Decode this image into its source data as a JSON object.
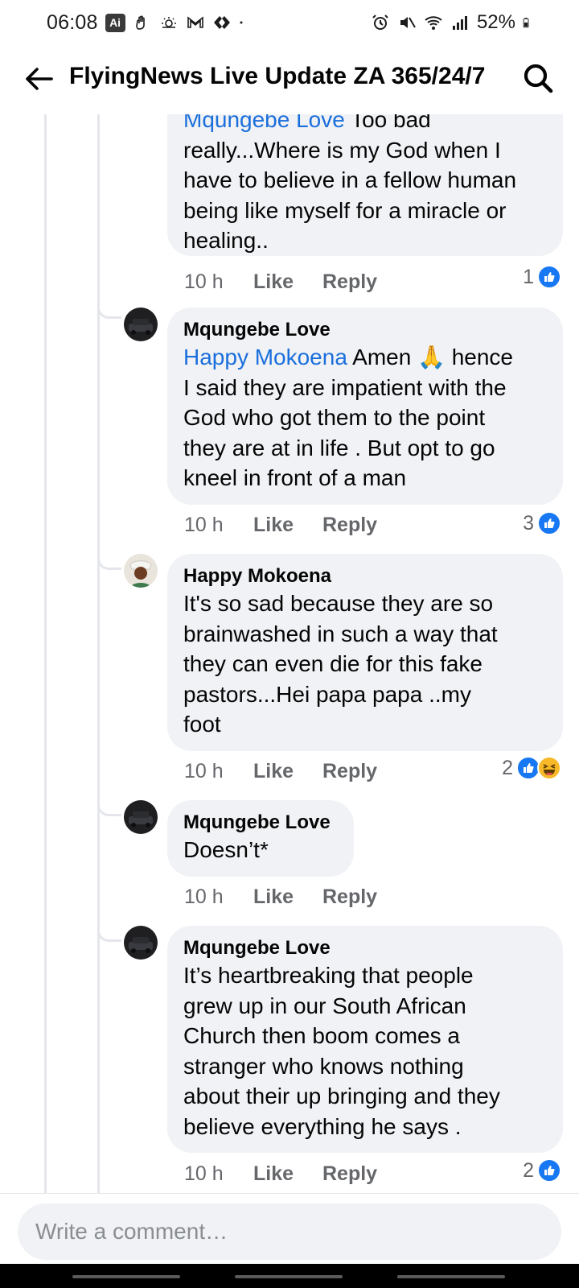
{
  "status_bar": {
    "time": "06:08",
    "ai_badge": "Ai",
    "battery": "52%"
  },
  "header": {
    "title": "FlyingNews Live Update ZA 365/24/7",
    "back_icon": "arrow-left-icon",
    "search_icon": "search-icon"
  },
  "comments": [
    {
      "author": "Mqungebe Love",
      "mention": "",
      "partial_first_line": "Mqungebe Love Too bad",
      "lines": [
        "really...Where is my God when I",
        "have to believe in a fellow human",
        "being like myself for a miracle or",
        "healing.."
      ],
      "time": "10 h",
      "like": "Like",
      "reply": "Reply",
      "reaction_count": "1",
      "reactions": [
        "like"
      ]
    },
    {
      "author": "Mqungebe Love",
      "mention": "Happy Mokoena",
      "first_line_rest": " Amen 🙏 hence",
      "lines": [
        "I said they are impatient with the",
        "God who got them to the point",
        "they are at in life . But opt to go",
        "kneel in front of a man"
      ],
      "time": "10 h",
      "like": "Like",
      "reply": "Reply",
      "reaction_count": "3",
      "reactions": [
        "like"
      ]
    },
    {
      "author": "Happy Mokoena",
      "lines": [
        "It's so sad because they are so",
        "brainwashed in such a way that",
        "they can even die for this fake",
        "pastors...Hei papa papa ..my",
        "foot"
      ],
      "time": "10 h",
      "like": "Like",
      "reply": "Reply",
      "reaction_count": "2",
      "reactions": [
        "like",
        "haha"
      ]
    },
    {
      "author": "Mqungebe Love",
      "lines": [
        "Doesn’t*"
      ],
      "time": "10 h",
      "like": "Like",
      "reply": "Reply",
      "reaction_count": "",
      "reactions": []
    },
    {
      "author": "Mqungebe Love",
      "lines": [
        "It’s heartbreaking that people",
        "grew up in our South African",
        "Church then boom comes a",
        "stranger who knows nothing",
        "about their up bringing and they",
        "believe everything he says ."
      ],
      "time": "10 h",
      "like": "Like",
      "reply": "Reply",
      "reaction_count": "2",
      "reactions": [
        "like"
      ]
    }
  ],
  "composer": {
    "placeholder": "Write a comment…"
  },
  "colors": {
    "link": "#1b6fdc",
    "bubble": "#f0f2f5",
    "like_blue": "#1877f2",
    "meta_gray": "#65676b"
  }
}
